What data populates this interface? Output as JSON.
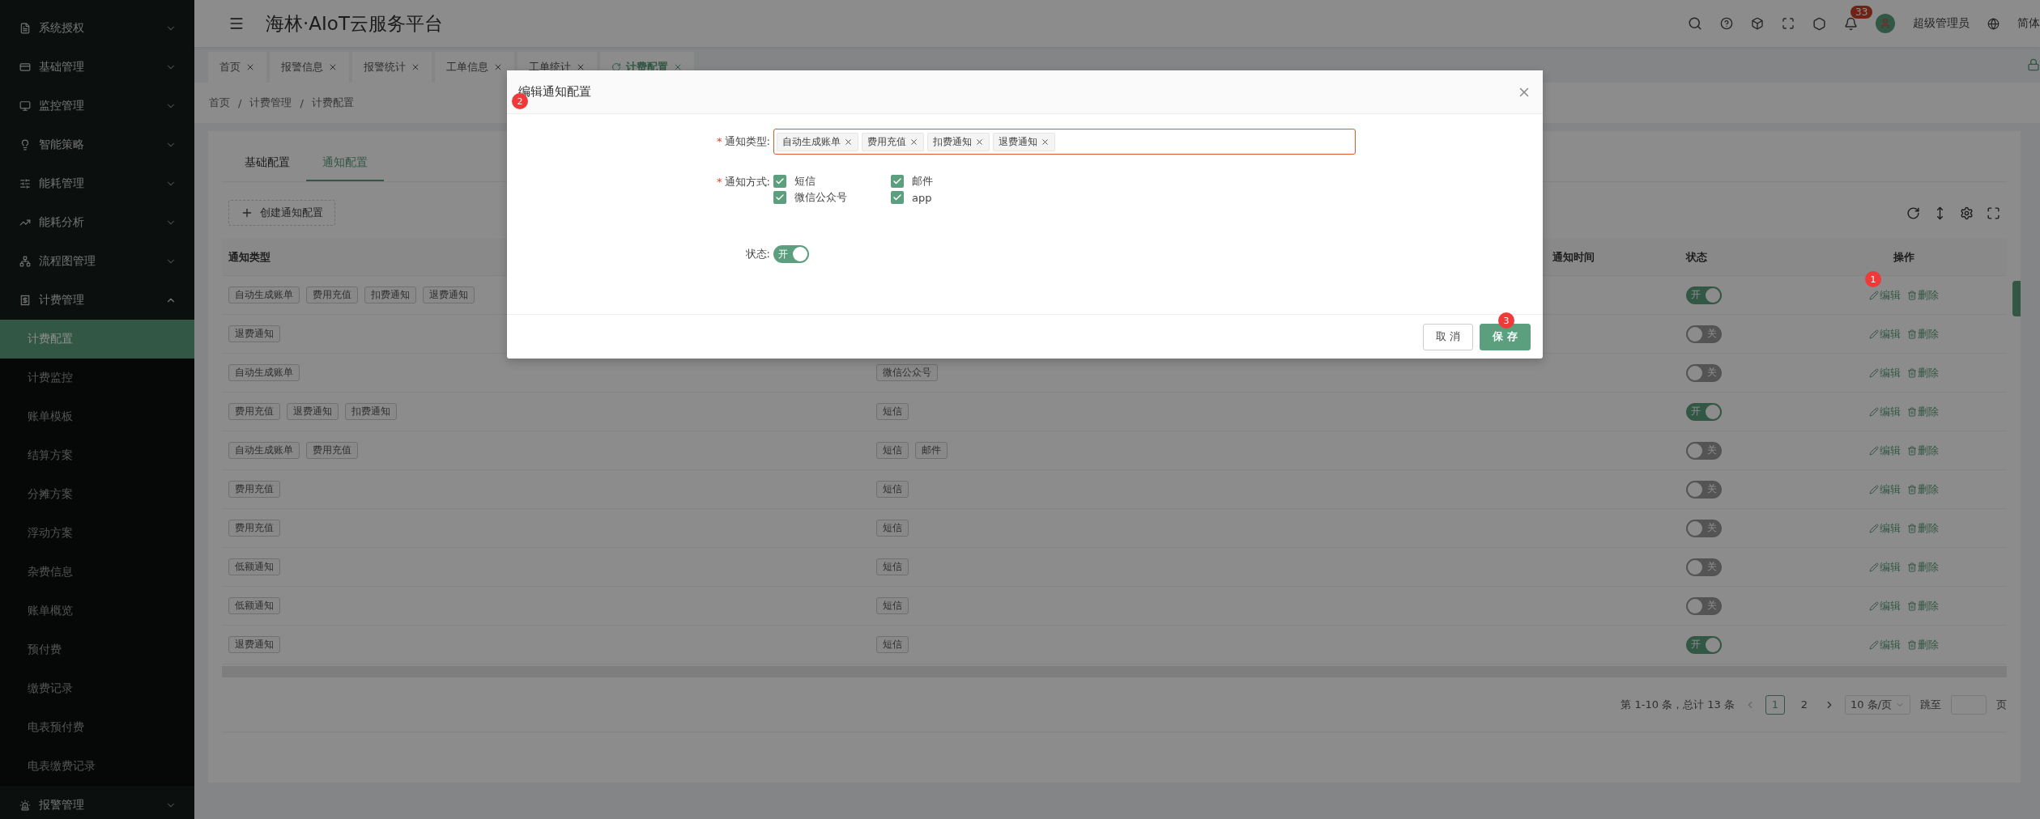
{
  "header": {
    "title": "海林·AIoT云服务平台",
    "notification_count": "33",
    "user": "超级管理员",
    "language": "简体"
  },
  "sidebar": {
    "items": [
      {
        "label": "系统授权",
        "expanded": false
      },
      {
        "label": "基础管理",
        "expanded": false
      },
      {
        "label": "监控管理",
        "expanded": false
      },
      {
        "label": "智能策略",
        "expanded": false
      },
      {
        "label": "能耗管理",
        "expanded": false
      },
      {
        "label": "能耗分析",
        "expanded": false
      },
      {
        "label": "流程图管理",
        "expanded": false
      },
      {
        "label": "计费管理",
        "expanded": true,
        "children": [
          {
            "label": "计费配置",
            "selected": true
          },
          {
            "label": "计费监控",
            "selected": false
          },
          {
            "label": "账单模板",
            "selected": false
          },
          {
            "label": "结算方案",
            "selected": false
          },
          {
            "label": "分摊方案",
            "selected": false
          },
          {
            "label": "浮动方案",
            "selected": false
          },
          {
            "label": "杂费信息",
            "selected": false
          },
          {
            "label": "账单概览",
            "selected": false
          },
          {
            "label": "预付费",
            "selected": false
          },
          {
            "label": "缴费记录",
            "selected": false
          },
          {
            "label": "电表预付费",
            "selected": false
          },
          {
            "label": "电表缴费记录",
            "selected": false
          }
        ]
      },
      {
        "label": "报警管理",
        "expanded": false
      }
    ]
  },
  "tabs": [
    {
      "label": "首页",
      "selected": false
    },
    {
      "label": "报警信息",
      "selected": false
    },
    {
      "label": "报警统计",
      "selected": false
    },
    {
      "label": "工单信息",
      "selected": false
    },
    {
      "label": "工单统计",
      "selected": false
    },
    {
      "label": "计费配置",
      "selected": true
    }
  ],
  "breadcrumb": [
    {
      "label": "首页"
    },
    {
      "separator": "/",
      "label": "计费管理"
    },
    {
      "separator": "/",
      "label": "计费配置"
    }
  ],
  "config_tabs": [
    {
      "label": "基础配置",
      "selected": false
    },
    {
      "label": "通知配置",
      "selected": true
    }
  ],
  "create_button": "创建通知配置",
  "table": {
    "headers": {
      "column_1": "通知类型",
      "column_3": "通知时间",
      "column_4": "状态",
      "column_5": "操作"
    },
    "rows": [
      {
        "types": [
          "自动生成账单",
          "费用充值",
          "扣费通知",
          "退费通知"
        ],
        "on": true,
        "switch_text": "开",
        "edit": "编辑",
        "delete": "删除"
      },
      {
        "types": [
          "退费通知"
        ],
        "on": false,
        "switch_text": "关",
        "edit": "编辑",
        "delete": "删除"
      },
      {
        "types": [
          "自动生成账单"
        ],
        "methods": [
          "微信公众号"
        ],
        "on": false,
        "switch_text": "关",
        "edit": "编辑",
        "delete": "删除"
      },
      {
        "types": [
          "费用充值",
          "退费通知",
          "扣费通知"
        ],
        "methods": [
          "短信"
        ],
        "on": true,
        "switch_text": "开",
        "edit": "编辑",
        "delete": "删除"
      },
      {
        "types": [
          "自动生成账单",
          "费用充值"
        ],
        "methods": [
          "短信",
          "邮件"
        ],
        "on": false,
        "switch_text": "关",
        "edit": "编辑",
        "delete": "删除"
      },
      {
        "types": [
          "费用充值"
        ],
        "methods": [
          "短信"
        ],
        "on": false,
        "switch_text": "关",
        "edit": "编辑",
        "delete": "删除"
      },
      {
        "types": [
          "费用充值"
        ],
        "methods": [
          "短信"
        ],
        "on": false,
        "switch_text": "关",
        "edit": "编辑",
        "delete": "删除"
      },
      {
        "types": [
          "低额通知"
        ],
        "methods": [
          "短信"
        ],
        "on": false,
        "switch_text": "关",
        "edit": "编辑",
        "delete": "删除"
      },
      {
        "types": [
          "低额通知"
        ],
        "methods": [
          "短信"
        ],
        "on": false,
        "switch_text": "关",
        "edit": "编辑",
        "delete": "删除"
      },
      {
        "types": [
          "退费通知"
        ],
        "methods": [
          "短信"
        ],
        "on": true,
        "switch_text": "开",
        "edit": "编辑",
        "delete": "删除"
      }
    ]
  },
  "pagination": {
    "summary": "第 1-10 条，总计 13 条",
    "pages": [
      {
        "label": "1",
        "selected": true
      },
      {
        "label": "2",
        "selected": false
      }
    ],
    "page_size": "10 条/页",
    "jump_label": "跳至",
    "page_suffix": "页"
  },
  "modal": {
    "title": "编辑通知配置",
    "fields": [
      {
        "kind": "tags",
        "label": "通知类型:",
        "required_mark": "*",
        "tags": [
          "自动生成账单",
          "费用充值",
          "扣费通知",
          "退费通知"
        ]
      },
      {
        "kind": "checkboxes",
        "label": "通知方式:",
        "required_mark": "*",
        "options": [
          {
            "label": "短信",
            "checked": true
          },
          {
            "label": "邮件",
            "checked": true
          },
          {
            "label": "微信公众号",
            "checked": true
          },
          {
            "label": "app",
            "checked": true
          }
        ]
      },
      {
        "kind": "switch",
        "label": "状态:",
        "on": true,
        "text": "开"
      }
    ],
    "buttons": [
      {
        "label": "取 消",
        "kind": "default"
      },
      {
        "label": "保 存",
        "kind": "primary"
      }
    ]
  },
  "annotations": [
    "1",
    "2",
    "3"
  ]
}
